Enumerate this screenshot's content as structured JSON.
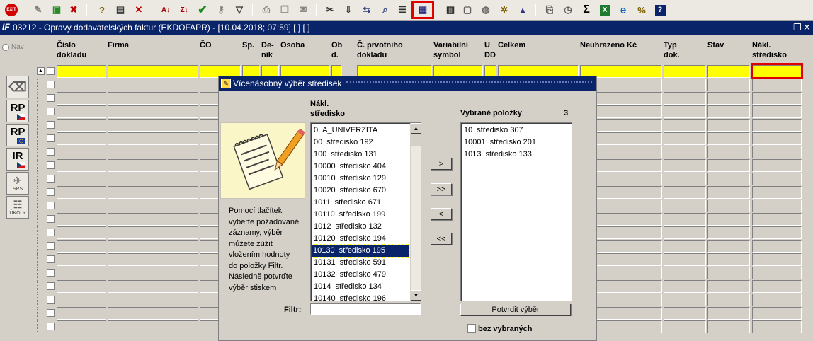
{
  "toolbar": {
    "exit_label": "EXIT",
    "icons": [
      "exit-icon",
      "insert-record-icon",
      "duplicate-record-icon",
      "delete-record-icon",
      "query-icon",
      "execute-query-icon",
      "cancel-query-icon",
      "sort-ascending-icon",
      "sort-descending-icon",
      "confirm-icon",
      "tools-icon",
      "filter-icon",
      "print-icon",
      "copy-icon",
      "mail-icon",
      "cut-icon",
      "paste-special-icon",
      "export-icon",
      "zoom-icon",
      "list-icon",
      "multi-select-icon",
      "calculator-icon",
      "save-icon",
      "globe-icon",
      "settings-icon",
      "warning-icon",
      "screenshot-icon",
      "clock-icon",
      "sum-icon",
      "excel-icon",
      "internet-explorer-icon",
      "percent-icon",
      "help-icon"
    ]
  },
  "window": {
    "title": "03212 - Opravy dodavatelských faktur (EKDOFAPR) - [10.04.2018; 07:59]  [ ]  [ ]",
    "logo": "IF"
  },
  "leftnav": {
    "nav_label": "Nav",
    "buttons": [
      {
        "label": "",
        "sub": ""
      },
      {
        "label": "RP",
        "sub": ""
      },
      {
        "label": "RP",
        "sub": ""
      },
      {
        "label": "IR",
        "sub": ""
      },
      {
        "label": "",
        "sub": "SPS"
      },
      {
        "label": "",
        "sub": "ÚKOLY"
      }
    ]
  },
  "grid": {
    "columns": [
      {
        "label1": "Číslo",
        "label2": "dokladu"
      },
      {
        "label1": "Firma",
        "label2": ""
      },
      {
        "label1": "ČO",
        "label2": ""
      },
      {
        "label1": "Sp.",
        "label2": ""
      },
      {
        "label1": "De-",
        "label2": "ník"
      },
      {
        "label1": "Osoba",
        "label2": ""
      },
      {
        "label1": "Ob",
        "label2": "d."
      },
      {
        "label1": "Č. prvotního",
        "label2": "dokladu"
      },
      {
        "label1": "Variabilní",
        "label2": "symbol"
      },
      {
        "label1": "U",
        "label2": "DD"
      },
      {
        "label1": "Celkem",
        "label2": ""
      },
      {
        "label1": "Neuhrazeno Kč",
        "label2": ""
      },
      {
        "label1": "Typ",
        "label2": "dok."
      },
      {
        "label1": "Stav",
        "label2": ""
      },
      {
        "label1": "Nákl.",
        "label2": "středisko"
      }
    ]
  },
  "dialog": {
    "title": "Vícenásobný výběr středisek",
    "left_header_1": "Nákl.",
    "left_header_2": "středisko",
    "right_header": "Vybrané položky",
    "selected_count": "3",
    "help_text": "Pomocí tlačítek vyberte požadované záznamy, výběr můžete zúžit vložením hodnoty do položky Filtr. Následně potvrďte výběr stiskem",
    "available": [
      {
        "code": "0",
        "name": "A_UNIVERZITA"
      },
      {
        "code": "00",
        "name": "středisko 192"
      },
      {
        "code": "100",
        "name": "středisko 131"
      },
      {
        "code": "10000",
        "name": "středisko 404"
      },
      {
        "code": "10010",
        "name": "středisko 129"
      },
      {
        "code": "10020",
        "name": "středisko 670"
      },
      {
        "code": "1011",
        "name": "středisko 671"
      },
      {
        "code": "10110",
        "name": "středisko 199"
      },
      {
        "code": "1012",
        "name": "středisko 132"
      },
      {
        "code": "10120",
        "name": "středisko 194"
      },
      {
        "code": "10130",
        "name": "středisko 195"
      },
      {
        "code": "10131",
        "name": "středisko 591"
      },
      {
        "code": "10132",
        "name": "středisko 479"
      },
      {
        "code": "1014",
        "name": "středisko 134"
      },
      {
        "code": "10140",
        "name": "středisko 196"
      }
    ],
    "selected_index": 10,
    "selected": [
      {
        "code": "10",
        "name": "středisko 307"
      },
      {
        "code": "10001",
        "name": "středisko 201"
      },
      {
        "code": "1013",
        "name": "středisko 133"
      }
    ],
    "btn_add": ">",
    "btn_add_all": ">>",
    "btn_remove": "<",
    "btn_remove_all": "<<",
    "filter_label": "Filtr:",
    "filter_value": "",
    "confirm_label": "Potvrdit výběr",
    "exclude_label": "bez vybraných"
  }
}
